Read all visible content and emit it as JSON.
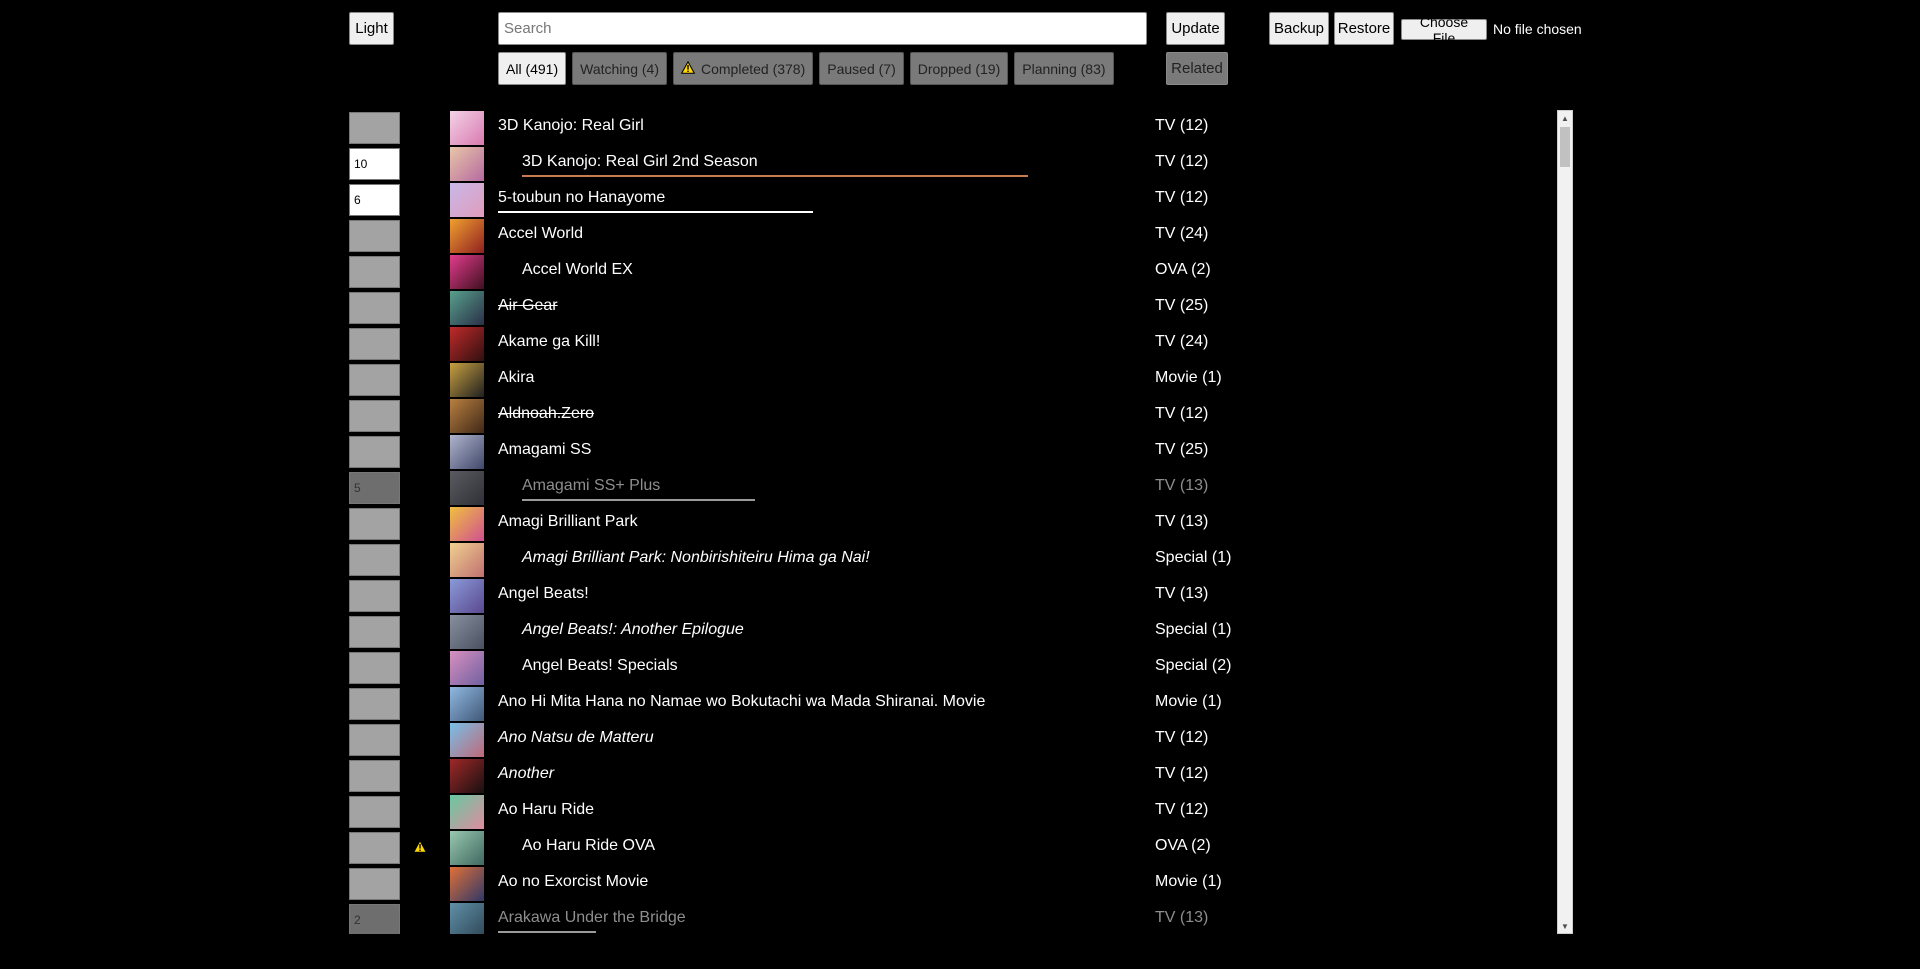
{
  "toolbar": {
    "theme_label": "Light",
    "search_placeholder": "Search",
    "update_label": "Update",
    "related_label": "Related",
    "backup_label": "Backup",
    "restore_label": "Restore",
    "choose_file_label": "Choose File",
    "no_file_text": "No file chosen"
  },
  "tabs": [
    {
      "label": "All (491)",
      "active": true,
      "warn": false
    },
    {
      "label": "Watching (4)",
      "active": false,
      "warn": false
    },
    {
      "label": "Completed (378)",
      "active": false,
      "warn": true
    },
    {
      "label": "Paused (7)",
      "active": false,
      "warn": false
    },
    {
      "label": "Dropped (19)",
      "active": false,
      "warn": false
    },
    {
      "label": "Planning (83)",
      "active": false,
      "warn": false
    }
  ],
  "colors": {
    "warning": "#ffd800",
    "underline_orange": "#c97a4e",
    "underline_white": "#ffffff",
    "underline_gray": "#9a9a9a"
  },
  "anime": [
    {
      "title": "3D Kanojo: Real Girl",
      "type": "TV (12)",
      "score": "",
      "score_style": "gray",
      "indent": false,
      "italic": false,
      "strike": false,
      "gray": false,
      "warn": false,
      "underline": null,
      "thumb": [
        "#f3d2e6",
        "#d97ab0"
      ]
    },
    {
      "title": "3D Kanojo: Real Girl 2nd Season",
      "type": "TV (12)",
      "score": "10",
      "score_style": "white",
      "indent": true,
      "italic": false,
      "strike": false,
      "gray": false,
      "warn": false,
      "underline": {
        "length": 506,
        "color": "#c97a4e"
      },
      "thumb": [
        "#e8c6a8",
        "#b66aa0"
      ]
    },
    {
      "title": "5-toubun no Hanayome",
      "type": "TV (12)",
      "score": "6",
      "score_style": "white",
      "indent": false,
      "italic": false,
      "strike": false,
      "gray": false,
      "warn": false,
      "underline": {
        "length": 315,
        "color": "#ffffff"
      },
      "thumb": [
        "#c8b8e8",
        "#e19cbc"
      ]
    },
    {
      "title": "Accel World",
      "type": "TV (24)",
      "score": "",
      "score_style": "gray",
      "indent": false,
      "italic": false,
      "strike": false,
      "gray": false,
      "warn": false,
      "underline": null,
      "thumb": [
        "#f0a030",
        "#902020"
      ]
    },
    {
      "title": "Accel World EX",
      "type": "OVA (2)",
      "score": "",
      "score_style": "gray",
      "indent": true,
      "italic": false,
      "strike": false,
      "gray": false,
      "warn": false,
      "underline": null,
      "thumb": [
        "#e23c8c",
        "#401020"
      ]
    },
    {
      "title": "Air Gear",
      "type": "TV (25)",
      "score": "",
      "score_style": "gray",
      "indent": false,
      "italic": false,
      "strike": true,
      "gray": false,
      "warn": false,
      "underline": null,
      "thumb": [
        "#58a08c",
        "#2a3048"
      ]
    },
    {
      "title": "Akame ga Kill!",
      "type": "TV (24)",
      "score": "",
      "score_style": "gray",
      "indent": false,
      "italic": false,
      "strike": false,
      "gray": false,
      "warn": false,
      "underline": null,
      "thumb": [
        "#c02a2a",
        "#301010"
      ]
    },
    {
      "title": "Akira",
      "type": "Movie (1)",
      "score": "",
      "score_style": "gray",
      "indent": false,
      "italic": false,
      "strike": false,
      "gray": false,
      "warn": false,
      "underline": null,
      "thumb": [
        "#c8a040",
        "#202020"
      ]
    },
    {
      "title": "Aldnoah.Zero",
      "type": "TV (12)",
      "score": "",
      "score_style": "gray",
      "indent": false,
      "italic": false,
      "strike": true,
      "gray": false,
      "warn": false,
      "underline": null,
      "thumb": [
        "#b88040",
        "#402818"
      ]
    },
    {
      "title": "Amagami SS",
      "type": "TV (25)",
      "score": "",
      "score_style": "gray",
      "indent": false,
      "italic": false,
      "strike": false,
      "gray": false,
      "warn": false,
      "underline": null,
      "thumb": [
        "#b0b4cc",
        "#40486a"
      ]
    },
    {
      "title": "Amagami SS+ Plus",
      "type": "TV (13)",
      "score": "5",
      "score_style": "dark",
      "indent": true,
      "italic": false,
      "strike": false,
      "gray": true,
      "warn": false,
      "underline": {
        "length": 233,
        "color": "#9a9a9a"
      },
      "thumb": [
        "#5a5a60",
        "#303038"
      ]
    },
    {
      "title": "Amagi Brilliant Park",
      "type": "TV (13)",
      "score": "",
      "score_style": "gray",
      "indent": false,
      "italic": false,
      "strike": false,
      "gray": false,
      "warn": false,
      "underline": null,
      "thumb": [
        "#f0c040",
        "#d05090"
      ]
    },
    {
      "title": "Amagi Brilliant Park: Nonbirishiteiru Hima ga Nai!",
      "type": "Special (1)",
      "score": "",
      "score_style": "gray",
      "indent": true,
      "italic": true,
      "strike": false,
      "gray": false,
      "warn": false,
      "underline": null,
      "thumb": [
        "#f0d090",
        "#c07070"
      ]
    },
    {
      "title": "Angel Beats!",
      "type": "TV (13)",
      "score": "",
      "score_style": "gray",
      "indent": false,
      "italic": false,
      "strike": false,
      "gray": false,
      "warn": false,
      "underline": null,
      "thumb": [
        "#8a9ad8",
        "#5a4890"
      ]
    },
    {
      "title": "Angel Beats!: Another Epilogue",
      "type": "Special (1)",
      "score": "",
      "score_style": "gray",
      "indent": true,
      "italic": true,
      "strike": false,
      "gray": false,
      "warn": false,
      "underline": null,
      "thumb": [
        "#8890a0",
        "#4a5060"
      ]
    },
    {
      "title": "Angel Beats! Specials",
      "type": "Special (2)",
      "score": "",
      "score_style": "gray",
      "indent": true,
      "italic": false,
      "strike": false,
      "gray": false,
      "warn": false,
      "underline": null,
      "thumb": [
        "#d890c0",
        "#7060a0"
      ]
    },
    {
      "title": "Ano Hi Mita Hana no Namae wo Bokutachi wa Mada Shiranai. Movie",
      "type": "Movie (1)",
      "score": "",
      "score_style": "gray",
      "indent": false,
      "italic": false,
      "strike": false,
      "gray": false,
      "warn": false,
      "underline": null,
      "thumb": [
        "#90b8e0",
        "#405878"
      ]
    },
    {
      "title": "Ano Natsu de Matteru",
      "type": "TV (12)",
      "score": "",
      "score_style": "gray",
      "indent": false,
      "italic": true,
      "strike": false,
      "gray": false,
      "warn": false,
      "underline": null,
      "thumb": [
        "#78c0e8",
        "#c06878"
      ]
    },
    {
      "title": "Another",
      "type": "TV (12)",
      "score": "",
      "score_style": "gray",
      "indent": false,
      "italic": true,
      "strike": false,
      "gray": false,
      "warn": false,
      "underline": null,
      "thumb": [
        "#a02828",
        "#181010"
      ]
    },
    {
      "title": "Ao Haru Ride",
      "type": "TV (12)",
      "score": "",
      "score_style": "gray",
      "indent": false,
      "italic": false,
      "strike": false,
      "gray": false,
      "warn": false,
      "underline": null,
      "thumb": [
        "#68c8a0",
        "#e08ca0"
      ]
    },
    {
      "title": "Ao Haru Ride OVA",
      "type": "OVA (2)",
      "score": "",
      "score_style": "gray",
      "indent": true,
      "italic": false,
      "strike": false,
      "gray": false,
      "warn": true,
      "underline": null,
      "thumb": [
        "#98c8b0",
        "#406860"
      ]
    },
    {
      "title": "Ao no Exorcist Movie",
      "type": "Movie (1)",
      "score": "",
      "score_style": "gray",
      "indent": false,
      "italic": false,
      "strike": false,
      "gray": false,
      "warn": false,
      "underline": null,
      "thumb": [
        "#e07038",
        "#303868"
      ]
    },
    {
      "title": "Arakawa Under the Bridge",
      "type": "TV (13)",
      "score": "2",
      "score_style": "dark",
      "indent": false,
      "italic": false,
      "strike": false,
      "gray": true,
      "warn": false,
      "underline": {
        "length": 98,
        "color": "#9a9a9a"
      },
      "thumb": [
        "#6090a8",
        "#304858"
      ]
    }
  ]
}
